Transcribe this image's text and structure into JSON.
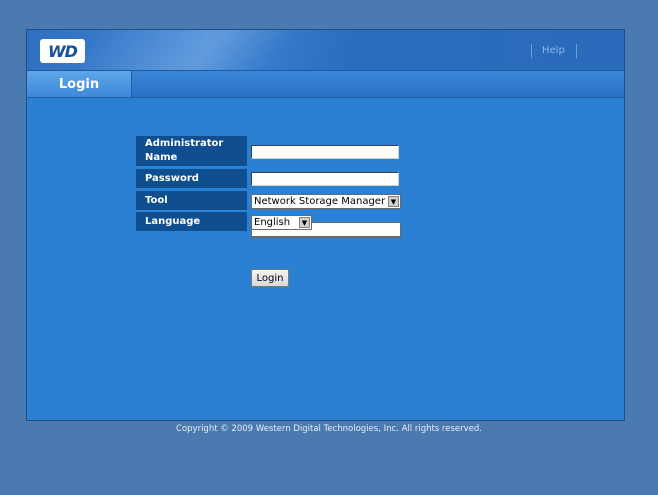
{
  "header": {
    "logo_text": "WD",
    "help_label": "Help"
  },
  "tabs": [
    {
      "label": "Login"
    }
  ],
  "form": {
    "admin_label_line1": "Administrator",
    "admin_label_line2": "Name",
    "admin_value": "",
    "password_label": "Password",
    "password_value": "",
    "tool_label": "Tool",
    "tool_selected": "Network Storage Manager",
    "language_label": "Language",
    "language_selected": "English",
    "login_button": "Login"
  },
  "footer": {
    "copyright": "Copyright © 2009 Western Digital Technologies, Inc. All rights reserved."
  },
  "colors": {
    "page_bg": "#4a7ab0",
    "frame_bg": "#2a80d2",
    "label_bg": "#0f4f8f"
  }
}
